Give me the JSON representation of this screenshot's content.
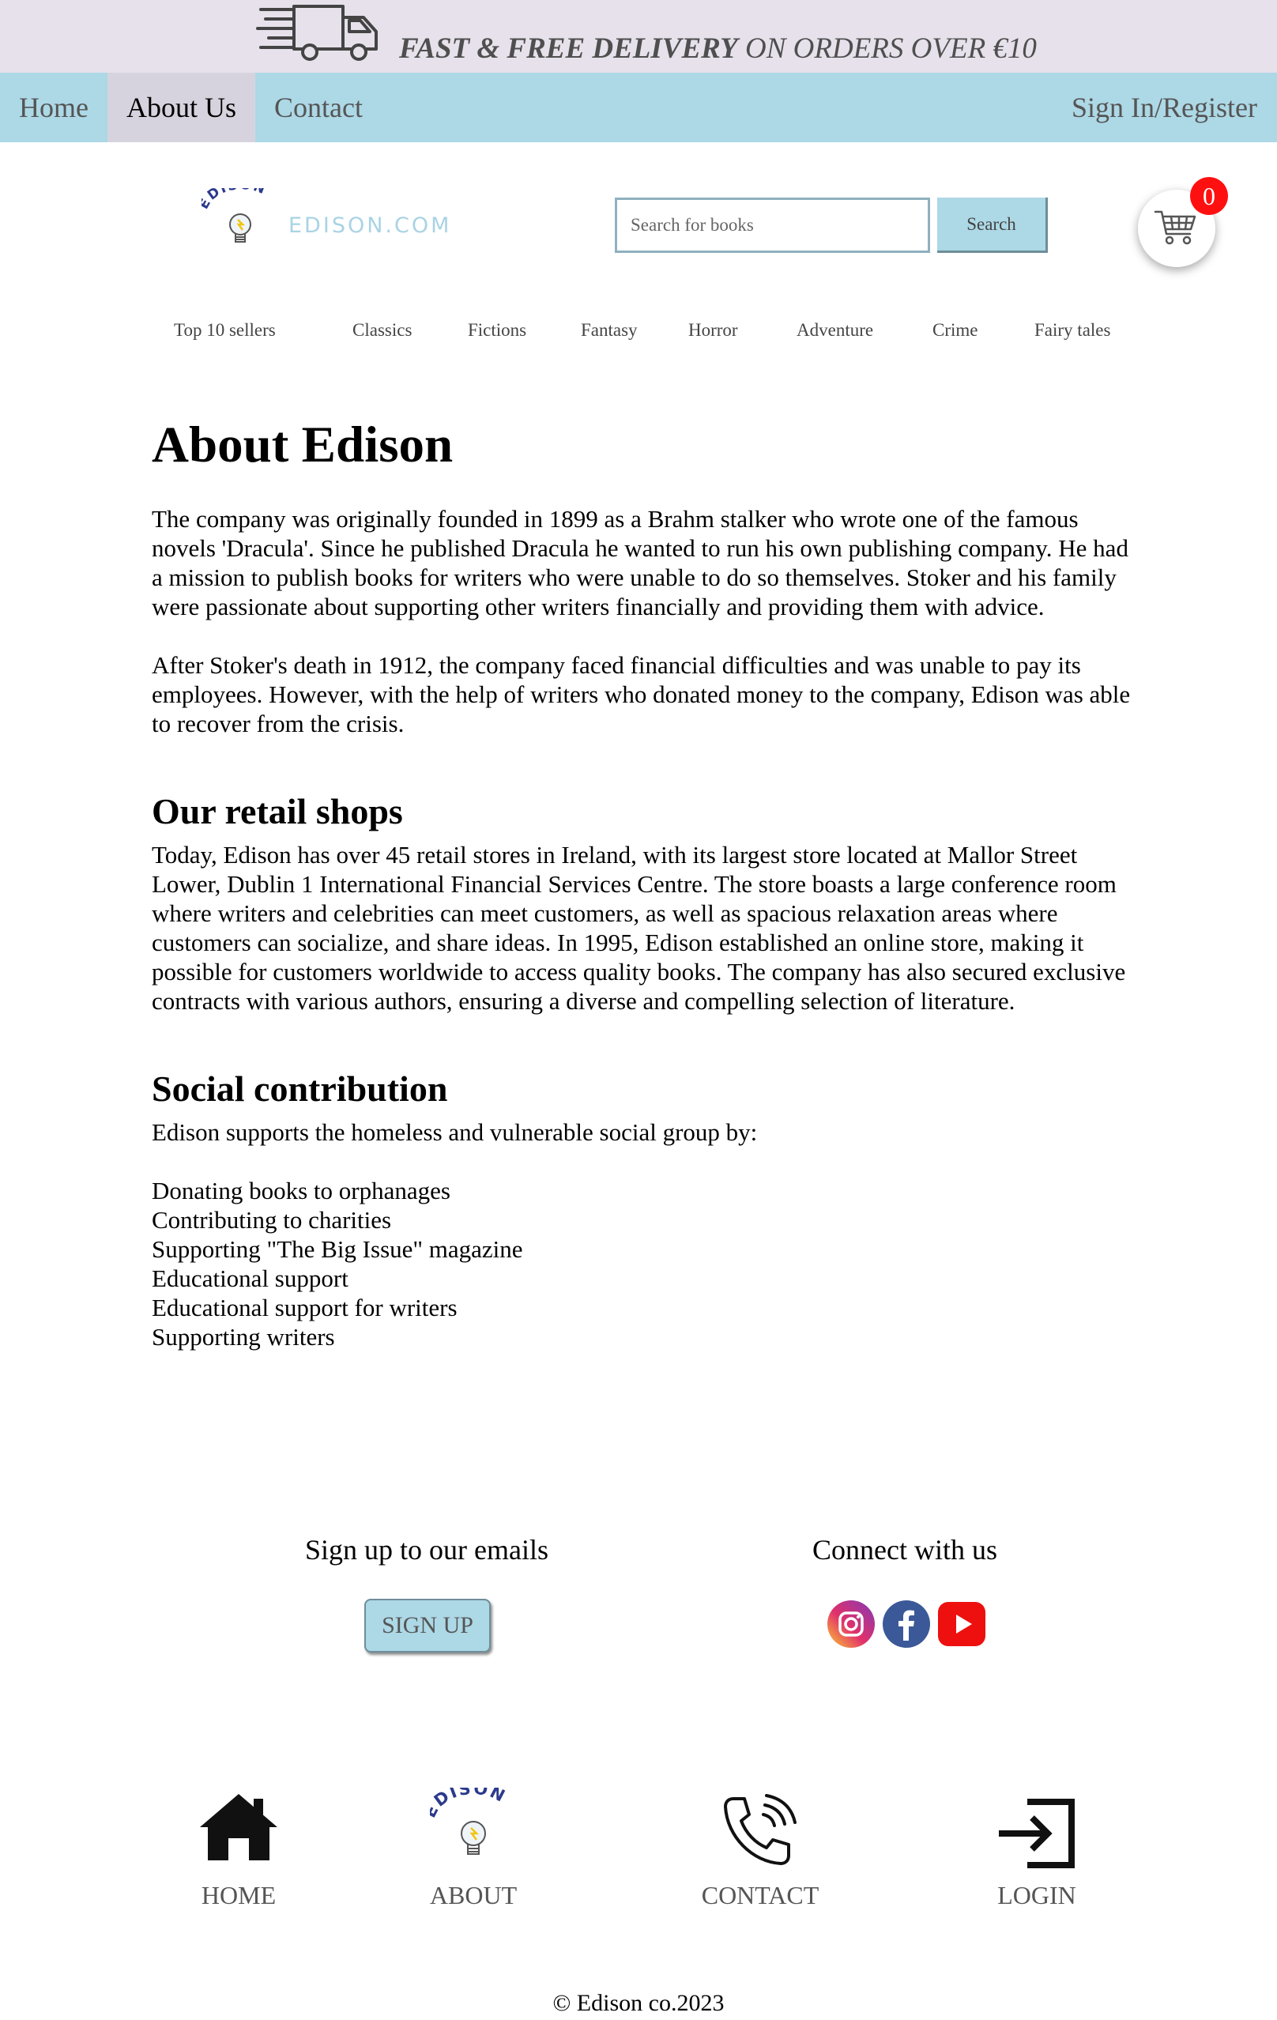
{
  "banner": {
    "promo_bold": "FAST & FREE DELIVERY",
    "promo_rest": " ON ORDERS OVER €10",
    "icon": "delivery-truck-icon"
  },
  "nav": {
    "home": "Home",
    "about": "About Us",
    "contact": "Contact",
    "signin": "Sign In/Register",
    "active": "About Us",
    "bg_color": "#add8e6"
  },
  "header": {
    "logo_arc": "EDISON",
    "logo_text": "EDISON.COM",
    "search_placeholder": "Search for books",
    "search_button": "Search",
    "cart_count": "0",
    "cart_icon": "shopping-cart-icon"
  },
  "categories": [
    "Top 10 sellers",
    "Classics",
    "Fictions",
    "Fantasy",
    "Horror",
    "Adventure",
    "Crime",
    "Fairy tales"
  ],
  "content": {
    "title": "About Edison",
    "para1": "The company was originally founded in 1899 as a Brahm stalker who wrote one of the famous novels 'Dracula'. Since he published Dracula he wanted to run his own publishing company. He had a mission to publish books for writers who were unable to do so themselves. Stoker and his family were passionate about supporting other writers financially and providing them with advice.",
    "para2": "After Stoker's death in 1912, the company faced financial difficulties and was unable to pay its employees. However, with the help of writers who donated money to the company, Edison was able to recover from the crisis.",
    "retail_heading": "Our retail shops",
    "retail_para": "Today, Edison has over 45 retail stores in Ireland, with its largest store located at Mallor Street Lower, Dublin 1 International Financial Services Centre. The store boasts a large conference room where writers and celebrities can meet customers, as well as spacious relaxation areas where customers can socialize, and share ideas. In 1995, Edison established an online store, making it possible for customers worldwide to access quality books. The company has also secured exclusive contracts with various authors, ensuring a diverse and compelling selection of literature.",
    "social_heading": "Social contribution",
    "social_intro": "Edison supports the homeless and vulnerable social group by:",
    "social_items": [
      "Donating books to orphanages",
      "Contributing to charities",
      "Supporting \"The Big Issue\" magazine",
      "Educational support",
      "Educational support for writers",
      "Supporting writers"
    ]
  },
  "footer": {
    "signup_title": "Sign up to our emails",
    "signup_button": "SIGN UP",
    "connect_title": "Connect with us",
    "social_icons": [
      "instagram-icon",
      "facebook-icon",
      "youtube-icon"
    ],
    "links": [
      "HOME",
      "ABOUT",
      "CONTACT",
      "LOGIN"
    ],
    "copyright": "© Edison co.2023"
  }
}
